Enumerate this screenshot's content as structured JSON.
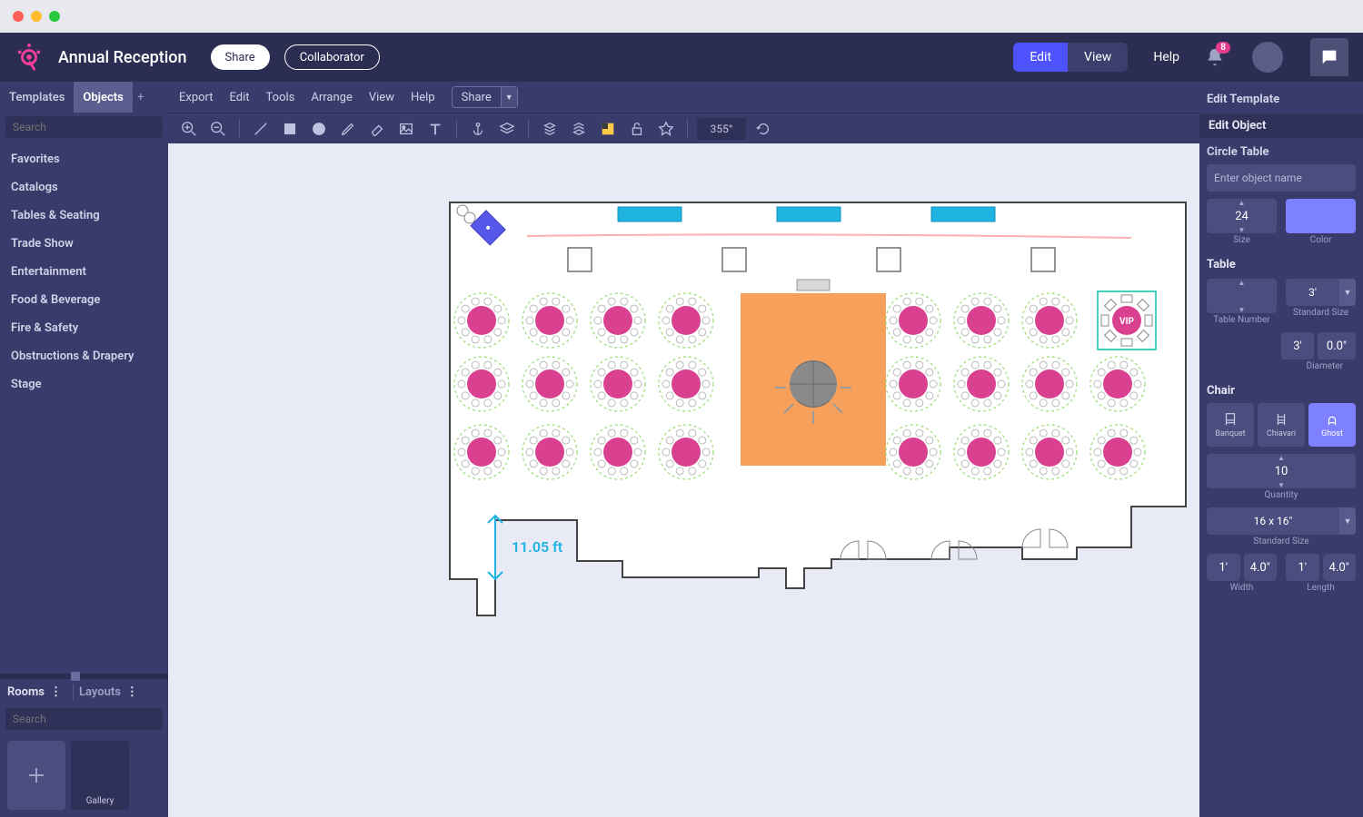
{
  "header": {
    "title": "Annual Reception",
    "share_label": "Share",
    "collab_label": "Collaborator",
    "edit_label": "Edit",
    "view_label": "View",
    "help_label": "Help",
    "notif_count": "8"
  },
  "left_panel": {
    "tabs": {
      "templates": "Templates",
      "objects": "Objects"
    },
    "search_placeholder": "Search",
    "categories": [
      "Favorites",
      "Catalogs",
      "Tables & Seating",
      "Trade Show",
      "Entertainment",
      "Food & Beverage",
      "Fire & Safety",
      "Obstructions & Drapery",
      "Stage"
    ],
    "rooms_label": "Rooms",
    "layouts_label": "Layouts",
    "rooms_search_placeholder": "Search",
    "gallery_label": "Gallery"
  },
  "menubar": {
    "items": [
      "Export",
      "Edit",
      "Tools",
      "Arrange",
      "View",
      "Help"
    ],
    "share_label": "Share"
  },
  "toolbar": {
    "rotation": "355°"
  },
  "canvas": {
    "dimension_label": "11.05 ft",
    "vip_label": "VIP"
  },
  "right_panel": {
    "edit_template_label": "Edit Template",
    "edit_object_label": "Edit Object",
    "object_type": "Circle Table",
    "name_placeholder": "Enter object name",
    "size_value": "24",
    "size_label": "Size",
    "color_label": "Color",
    "table_section": "Table",
    "table_number_label": "Table Number",
    "standard_size_label": "Standard Size",
    "standard_size_value": "3'",
    "diameter_label": "Diameter",
    "diameter_ft": "3'",
    "diameter_in": "0.0\"",
    "chair_section": "Chair",
    "chair_types": [
      "Banquet",
      "Chiavari",
      "Ghost"
    ],
    "chair_selected": 2,
    "quantity_value": "10",
    "quantity_label": "Quantity",
    "chair_standard_size_value": "16 x 16\"",
    "width_label": "Width",
    "length_label": "Length",
    "width_ft": "1'",
    "width_in": "4.0\"",
    "length_ft": "1'",
    "length_in": "4.0\""
  }
}
